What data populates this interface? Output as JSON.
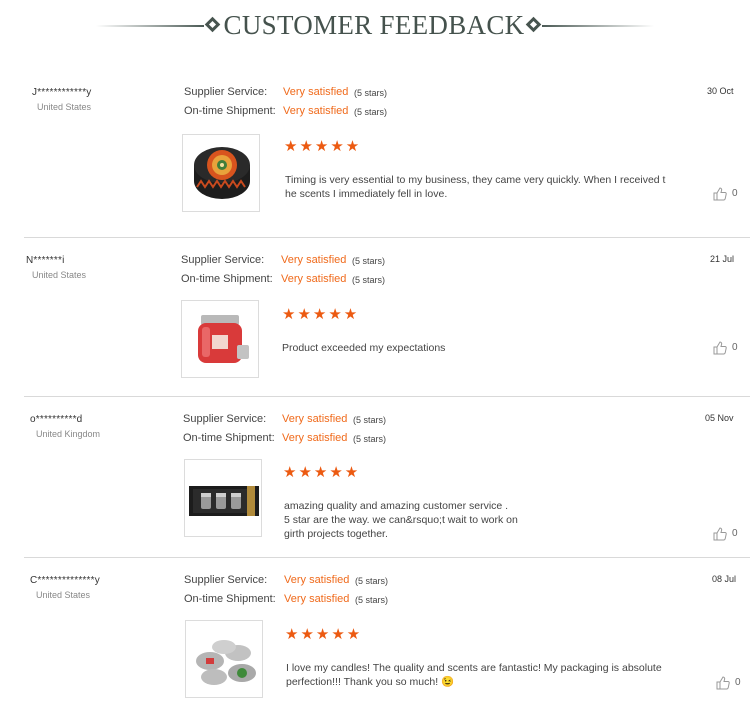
{
  "header": {
    "title": "CUSTOMER FEEDBACK"
  },
  "labels": {
    "supplier": "Supplier Service:",
    "shipment": "On-time Shipment:"
  },
  "rating_stars": "★★★★★",
  "reviews": [
    {
      "user": "J************y",
      "country": "United States",
      "supplier_rating": "Very satisfied",
      "supplier_stars": "(5 stars)",
      "shipment_rating": "Very satisfied",
      "shipment_stars": "(5 stars)",
      "date": "30 Oct",
      "comment": "Timing is very essential to my business, they came very quickly. When I received t he scents I immediately fell in love.",
      "likes": "0",
      "product": "patterned round candle tin"
    },
    {
      "user": "N*******i",
      "country": "United States",
      "supplier_rating": "Very satisfied",
      "supplier_stars": "(5 stars)",
      "shipment_rating": "Very satisfied",
      "shipment_stars": "(5 stars)",
      "date": "21 Jul",
      "comment": "Product exceeded my expectations",
      "likes": "0",
      "product": "red glass candle jar"
    },
    {
      "user": "o**********d",
      "country": "United Kingdom",
      "supplier_rating": "Very satisfied",
      "supplier_stars": "(5 stars)",
      "shipment_rating": "Very satisfied",
      "shipment_stars": "(5 stars)",
      "date": "05 Nov",
      "comment": "amazing quality and amazing customer service .\n5 star are the way. we can&rsquo;t wait to work on\ngirth projects together.",
      "likes": "0",
      "product": "black gift box with three candles"
    },
    {
      "user": "C**************y",
      "country": "United States",
      "supplier_rating": "Very satisfied",
      "supplier_stars": "(5 stars)",
      "shipment_rating": "Very satisfied",
      "shipment_stars": "(5 stars)",
      "date": "08 Jul",
      "comment": "I love my candles! The quality and scents are fantastic! My packaging is absolute perfection!!! Thank you so much! 😉",
      "likes": "0",
      "product": "silver candle tins"
    }
  ]
}
